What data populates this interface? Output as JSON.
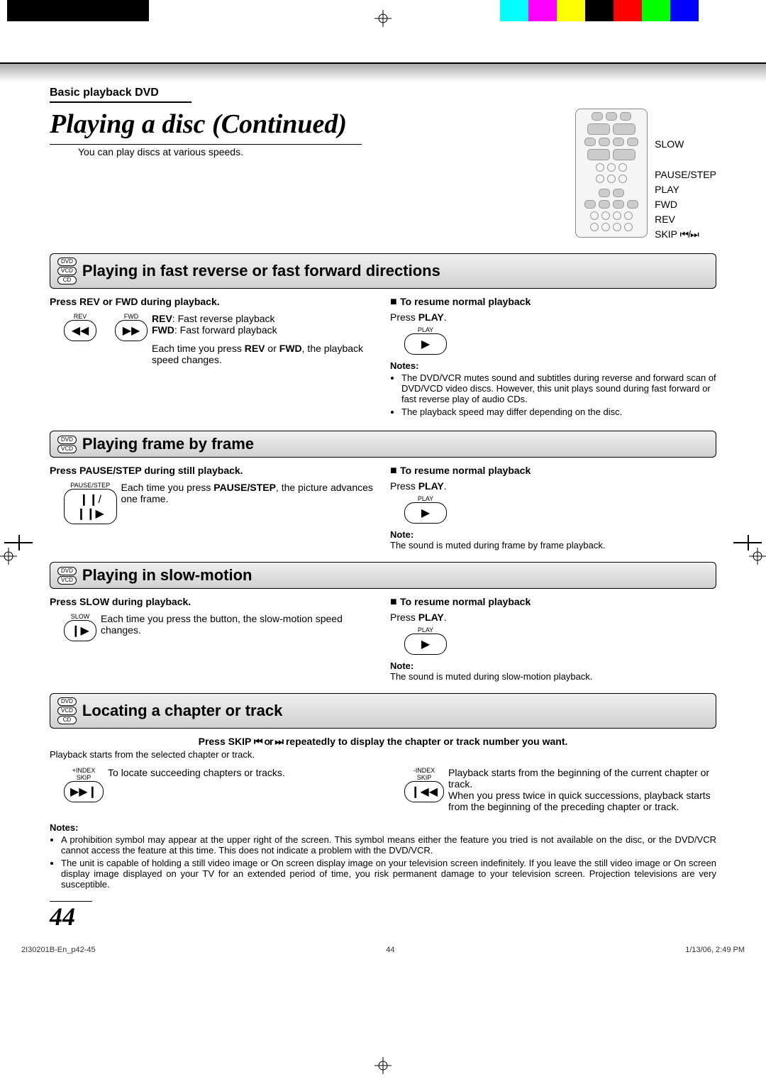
{
  "header": {
    "section_label": "Basic playback DVD"
  },
  "title": "Playing a disc (Continued)",
  "intro": "You can play discs at various speeds.",
  "remote_labels": [
    "SLOW",
    "PAUSE/STEP",
    "PLAY",
    "FWD",
    "REV"
  ],
  "remote_skip": {
    "label": "SKIP",
    "icons": "⏮/⏭"
  },
  "sections": [
    {
      "tags": [
        "DVD",
        "VCD",
        "CD"
      ],
      "title": "Playing in fast reverse or fast forward directions",
      "left": {
        "heading": "Press REV or FWD during playback.",
        "btn1_label": "REV",
        "btn1_glyph": "◀◀",
        "btn2_label": "FWD",
        "btn2_glyph": "▶▶",
        "desc_rev_b": "REV",
        "desc_rev": ":  Fast reverse playback",
        "desc_fwd_b": "FWD",
        "desc_fwd": ": Fast forward playback",
        "desc2a": "Each time you press ",
        "desc2b1": "REV",
        "desc2m": " or ",
        "desc2b2": "FWD",
        "desc2c": ", the playback speed changes."
      },
      "right": {
        "resume_h": "To resume normal playback",
        "resume_t1": "Press ",
        "resume_b": "PLAY",
        "resume_t2": ".",
        "play_label": "PLAY",
        "play_glyph": "▶",
        "notes_h": "Notes:",
        "notes": [
          "The DVD/VCR mutes sound and subtitles during reverse and forward scan of DVD/VCD video discs. However, this unit plays sound during fast forward or fast reverse play of audio CDs.",
          "The playback speed may differ depending on the disc."
        ]
      }
    },
    {
      "tags": [
        "DVD",
        "VCD"
      ],
      "title": "Playing frame by frame",
      "left": {
        "heading": "Press PAUSE/STEP during still playback.",
        "btn_label": "PAUSE/STEP",
        "btn_glyph": "❙❙/❙❙▶",
        "desc_a": "Each time you press ",
        "desc_b": "PAUSE/STEP",
        "desc_c": ", the picture advances one frame."
      },
      "right": {
        "resume_h": "To resume normal playback",
        "resume_t1": "Press ",
        "resume_b": "PLAY",
        "resume_t2": ".",
        "play_label": "PLAY",
        "play_glyph": "▶",
        "note_h": "Note:",
        "note": "The sound is muted during frame by frame playback."
      }
    },
    {
      "tags": [
        "DVD",
        "VCD"
      ],
      "title": "Playing in slow-motion",
      "left": {
        "heading": "Press SLOW during playback.",
        "btn_label": "SLOW",
        "btn_glyph": "❙▶",
        "desc": "Each time you press the button, the slow-motion speed changes."
      },
      "right": {
        "resume_h": "To resume normal playback",
        "resume_t1": "Press ",
        "resume_b": "PLAY",
        "resume_t2": ".",
        "play_label": "PLAY",
        "play_glyph": "▶",
        "note_h": "Note:",
        "note": "The sound is muted during slow-motion playback."
      }
    },
    {
      "tags": [
        "DVD",
        "VCD",
        "CD"
      ],
      "title": "Locating a chapter or track",
      "heading_a": "Press SKIP ",
      "heading_icons": "⏮ or ⏭",
      "heading_b": " repeatedly to display the chapter or track number you want.",
      "sub": "Playback starts from the selected chapter or track.",
      "left": {
        "btn_label1": "+INDEX",
        "btn_label2": "SKIP",
        "btn_glyph": "▶▶❙",
        "desc": "To locate succeeding chapters or tracks."
      },
      "right": {
        "btn_label1": "-INDEX",
        "btn_label2": "SKIP",
        "btn_glyph": "❙◀◀",
        "desc1": "Playback starts from the beginning of the current chapter or track.",
        "desc2": "When you press twice in quick successions, playback starts from the beginning of the preceding chapter or track."
      },
      "notes_h": "Notes:",
      "notes": [
        "A prohibition symbol may appear at the upper right of the screen. This symbol means either the feature you tried is not available on the disc, or the DVD/VCR cannot access the feature at this time. This does not indicate a problem with the DVD/VCR.",
        "The unit is capable of holding a still video image or On screen display image on your television screen indefinitely. If you leave the still video image or On screen display image displayed on your TV for an extended period of time, you risk permanent damage to your television screen. Projection televisions are very susceptible."
      ]
    }
  ],
  "page_num": "44",
  "footer": {
    "file": "2I30201B-En_p42-45",
    "page": "44",
    "date": "1/13/06, 2:49 PM"
  }
}
